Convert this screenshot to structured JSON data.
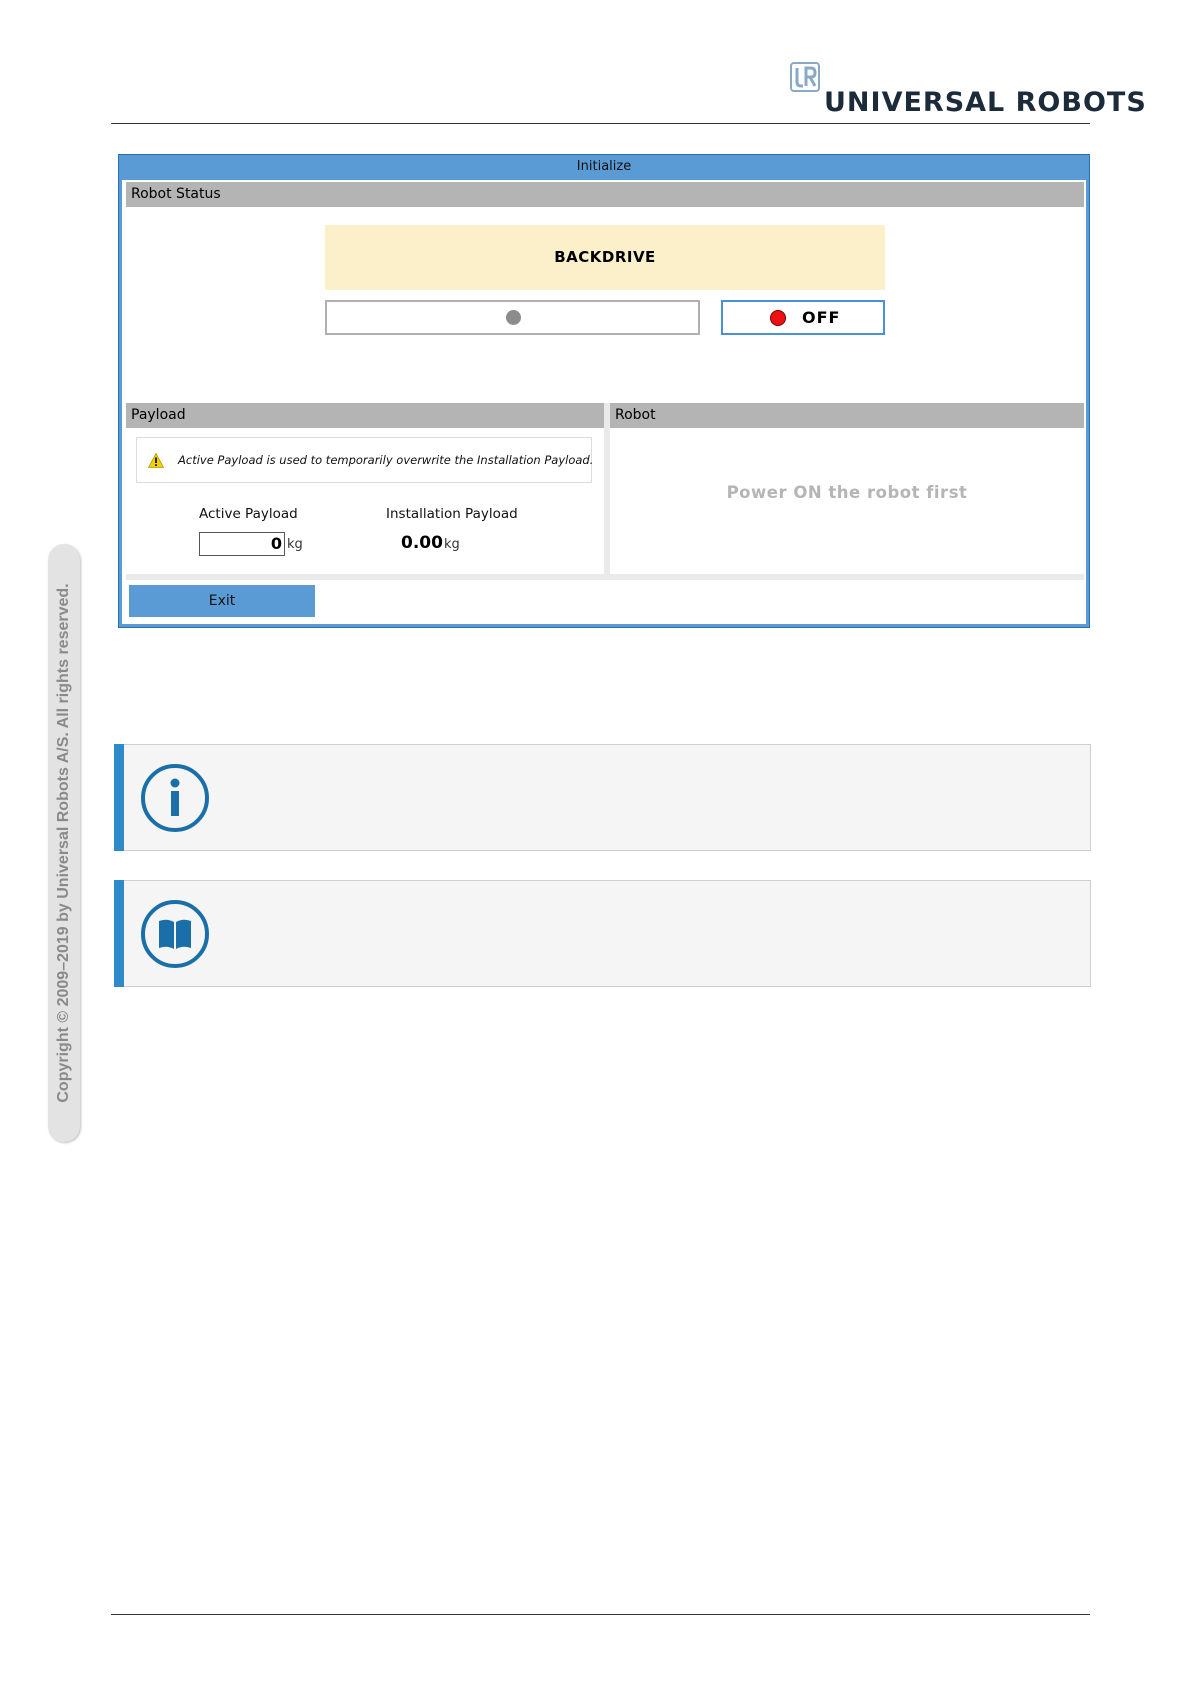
{
  "brand": {
    "name": "UNIVERSAL ROBOTS",
    "mark": "UR"
  },
  "side_copyright": "Copyright © 2009–2019 by Universal Robots A/S. All rights reserved.",
  "window": {
    "title": "Initialize",
    "robot_status": {
      "header": "Robot Status",
      "mode": "BACKDRIVE",
      "power_button_label": "OFF"
    },
    "payload": {
      "header": "Payload",
      "warning": "Active Payload is used to temporarily overwrite the Installation Payload.",
      "active_label": "Active Payload",
      "active_value": "0",
      "active_unit": "kg",
      "installation_label": "Installation Payload",
      "installation_value": "0.00",
      "installation_unit": "kg"
    },
    "robot": {
      "header": "Robot",
      "message": "Power ON the robot first"
    },
    "exit_label": "Exit"
  },
  "icons": {
    "info": "info-icon",
    "manual": "book-icon",
    "warning": "warning-icon"
  },
  "colors": {
    "accent_blue": "#2f8ac9",
    "title_bar": "#5b9bd5",
    "backdrive_bg": "#fbf0c9",
    "power_off_dot": "#ee1111"
  }
}
